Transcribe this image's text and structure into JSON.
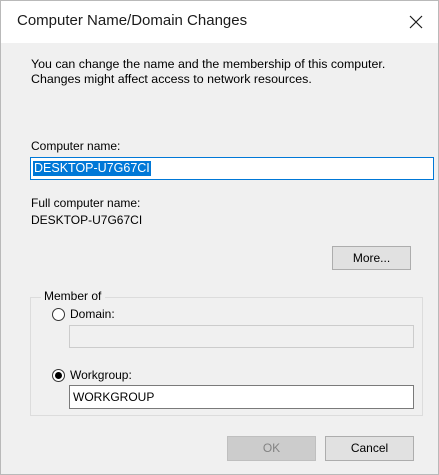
{
  "window": {
    "title": "Computer Name/Domain Changes"
  },
  "description": "You can change the name and the membership of this computer. Changes might affect access to network resources.",
  "computer_name": {
    "label": "Computer name:",
    "value": "DESKTOP-U7G67CI"
  },
  "full_computer_name": {
    "label": "Full computer name:",
    "value": "DESKTOP-U7G67CI"
  },
  "more_button": "More...",
  "member_of": {
    "legend": "Member of",
    "domain_label": "Domain:",
    "domain_value": "",
    "domain_selected": false,
    "workgroup_label": "Workgroup:",
    "workgroup_value": "WORKGROUP",
    "workgroup_selected": true
  },
  "buttons": {
    "ok": "OK",
    "cancel": "Cancel"
  },
  "colors": {
    "accent": "#0078d7",
    "dialog_bg": "#f0f0f0"
  }
}
